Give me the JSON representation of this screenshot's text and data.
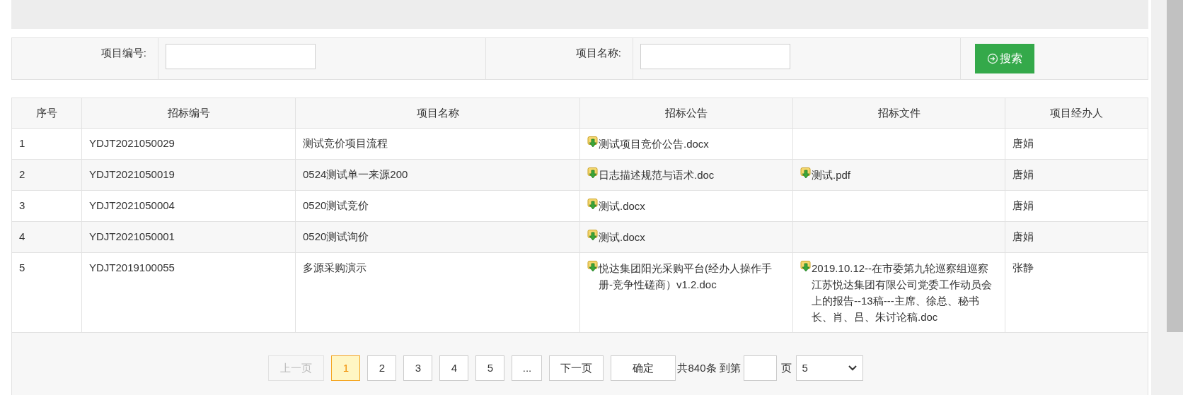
{
  "search": {
    "fields": [
      {
        "label": "项目编号:"
      },
      {
        "label": "项目名称:"
      }
    ],
    "button": "搜索"
  },
  "table": {
    "columns": [
      "序号",
      "招标编号",
      "项目名称",
      "招标公告",
      "招标文件",
      "项目经办人"
    ],
    "rows": [
      {
        "index": "1",
        "code": "YDJT2021050029",
        "name": "测试竞价项目流程",
        "notice": "测试项目竞价公告.docx",
        "file": null,
        "manager": "唐娟"
      },
      {
        "index": "2",
        "code": "YDJT2021050019",
        "name": "0524测试单一来源200",
        "notice": "日志描述规范与语术.doc",
        "file": "测试.pdf",
        "manager": "唐娟"
      },
      {
        "index": "3",
        "code": "YDJT2021050004",
        "name": "0520测试竞价",
        "notice": "测试.docx",
        "file": null,
        "manager": "唐娟"
      },
      {
        "index": "4",
        "code": "YDJT2021050001",
        "name": "0520测试询价",
        "notice": "测试.docx",
        "file": null,
        "manager": "唐娟"
      },
      {
        "index": "5",
        "code": "YDJT2019100055",
        "name": "多源采购演示",
        "notice": "悦达集团阳光采购平台(经办人操作手册-竞争性磋商）v1.2.doc",
        "file": "2019.10.12--在市委第九轮巡察组巡察江苏悦达集团有限公司党委工作动员会上的报告--13稿---主席、徐总、秘书长、肖、吕、朱讨论稿.doc",
        "manager": "张静"
      }
    ]
  },
  "pagination": {
    "prev": {
      "label": "上一页",
      "disabled": true
    },
    "pages": [
      {
        "label": "1",
        "selected": true
      },
      {
        "label": "2",
        "selected": false
      },
      {
        "label": "3",
        "selected": false
      },
      {
        "label": "4",
        "selected": false
      },
      {
        "label": "5",
        "selected": false
      }
    ],
    "ellipsis": "...",
    "next": "下一页",
    "confirm": "确定",
    "total": "共840条",
    "goto": "到第",
    "page_unit": "页",
    "page_size": "5"
  }
}
